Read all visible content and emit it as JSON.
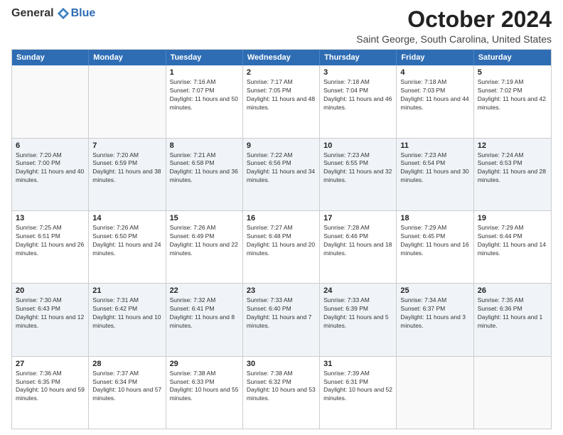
{
  "logo": {
    "text_general": "General",
    "text_blue": "Blue"
  },
  "header": {
    "month": "October 2024",
    "location": "Saint George, South Carolina, United States"
  },
  "weekdays": [
    "Sunday",
    "Monday",
    "Tuesday",
    "Wednesday",
    "Thursday",
    "Friday",
    "Saturday"
  ],
  "rows": [
    [
      {
        "day": "",
        "info": "",
        "empty": true
      },
      {
        "day": "",
        "info": "",
        "empty": true
      },
      {
        "day": "1",
        "info": "Sunrise: 7:16 AM\nSunset: 7:07 PM\nDaylight: 11 hours and 50 minutes."
      },
      {
        "day": "2",
        "info": "Sunrise: 7:17 AM\nSunset: 7:05 PM\nDaylight: 11 hours and 48 minutes."
      },
      {
        "day": "3",
        "info": "Sunrise: 7:18 AM\nSunset: 7:04 PM\nDaylight: 11 hours and 46 minutes."
      },
      {
        "day": "4",
        "info": "Sunrise: 7:18 AM\nSunset: 7:03 PM\nDaylight: 11 hours and 44 minutes."
      },
      {
        "day": "5",
        "info": "Sunrise: 7:19 AM\nSunset: 7:02 PM\nDaylight: 11 hours and 42 minutes."
      }
    ],
    [
      {
        "day": "6",
        "info": "Sunrise: 7:20 AM\nSunset: 7:00 PM\nDaylight: 11 hours and 40 minutes."
      },
      {
        "day": "7",
        "info": "Sunrise: 7:20 AM\nSunset: 6:59 PM\nDaylight: 11 hours and 38 minutes."
      },
      {
        "day": "8",
        "info": "Sunrise: 7:21 AM\nSunset: 6:58 PM\nDaylight: 11 hours and 36 minutes."
      },
      {
        "day": "9",
        "info": "Sunrise: 7:22 AM\nSunset: 6:56 PM\nDaylight: 11 hours and 34 minutes."
      },
      {
        "day": "10",
        "info": "Sunrise: 7:23 AM\nSunset: 6:55 PM\nDaylight: 11 hours and 32 minutes."
      },
      {
        "day": "11",
        "info": "Sunrise: 7:23 AM\nSunset: 6:54 PM\nDaylight: 11 hours and 30 minutes."
      },
      {
        "day": "12",
        "info": "Sunrise: 7:24 AM\nSunset: 6:53 PM\nDaylight: 11 hours and 28 minutes."
      }
    ],
    [
      {
        "day": "13",
        "info": "Sunrise: 7:25 AM\nSunset: 6:51 PM\nDaylight: 11 hours and 26 minutes."
      },
      {
        "day": "14",
        "info": "Sunrise: 7:26 AM\nSunset: 6:50 PM\nDaylight: 11 hours and 24 minutes."
      },
      {
        "day": "15",
        "info": "Sunrise: 7:26 AM\nSunset: 6:49 PM\nDaylight: 11 hours and 22 minutes."
      },
      {
        "day": "16",
        "info": "Sunrise: 7:27 AM\nSunset: 6:48 PM\nDaylight: 11 hours and 20 minutes."
      },
      {
        "day": "17",
        "info": "Sunrise: 7:28 AM\nSunset: 6:46 PM\nDaylight: 11 hours and 18 minutes."
      },
      {
        "day": "18",
        "info": "Sunrise: 7:29 AM\nSunset: 6:45 PM\nDaylight: 11 hours and 16 minutes."
      },
      {
        "day": "19",
        "info": "Sunrise: 7:29 AM\nSunset: 6:44 PM\nDaylight: 11 hours and 14 minutes."
      }
    ],
    [
      {
        "day": "20",
        "info": "Sunrise: 7:30 AM\nSunset: 6:43 PM\nDaylight: 11 hours and 12 minutes."
      },
      {
        "day": "21",
        "info": "Sunrise: 7:31 AM\nSunset: 6:42 PM\nDaylight: 11 hours and 10 minutes."
      },
      {
        "day": "22",
        "info": "Sunrise: 7:32 AM\nSunset: 6:41 PM\nDaylight: 11 hours and 8 minutes."
      },
      {
        "day": "23",
        "info": "Sunrise: 7:33 AM\nSunset: 6:40 PM\nDaylight: 11 hours and 7 minutes."
      },
      {
        "day": "24",
        "info": "Sunrise: 7:33 AM\nSunset: 6:39 PM\nDaylight: 11 hours and 5 minutes."
      },
      {
        "day": "25",
        "info": "Sunrise: 7:34 AM\nSunset: 6:37 PM\nDaylight: 11 hours and 3 minutes."
      },
      {
        "day": "26",
        "info": "Sunrise: 7:35 AM\nSunset: 6:36 PM\nDaylight: 11 hours and 1 minute."
      }
    ],
    [
      {
        "day": "27",
        "info": "Sunrise: 7:36 AM\nSunset: 6:35 PM\nDaylight: 10 hours and 59 minutes."
      },
      {
        "day": "28",
        "info": "Sunrise: 7:37 AM\nSunset: 6:34 PM\nDaylight: 10 hours and 57 minutes."
      },
      {
        "day": "29",
        "info": "Sunrise: 7:38 AM\nSunset: 6:33 PM\nDaylight: 10 hours and 55 minutes."
      },
      {
        "day": "30",
        "info": "Sunrise: 7:38 AM\nSunset: 6:32 PM\nDaylight: 10 hours and 53 minutes."
      },
      {
        "day": "31",
        "info": "Sunrise: 7:39 AM\nSunset: 6:31 PM\nDaylight: 10 hours and 52 minutes."
      },
      {
        "day": "",
        "info": "",
        "empty": true
      },
      {
        "day": "",
        "info": "",
        "empty": true
      }
    ]
  ]
}
